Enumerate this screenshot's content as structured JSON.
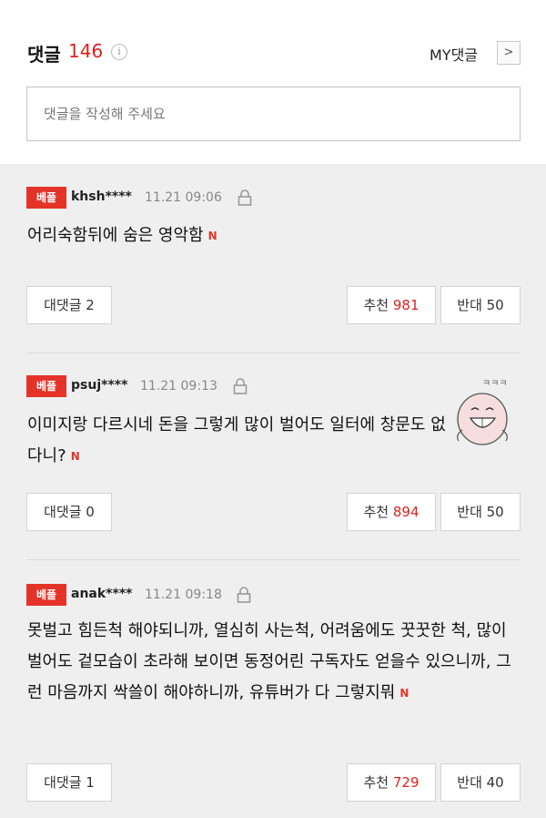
{
  "header": {
    "title": "댓글",
    "count": "146",
    "info_icon": "i",
    "my_link": "MY댓글",
    "arrow_icon": ">"
  },
  "input": {
    "placeholder": "댓글을 작성해 주세요"
  },
  "comments": [
    {
      "badge": "베플",
      "author": "khsh****",
      "time": "11.21 09:06",
      "text": "어리숙함뒤에 숨은 영악함",
      "new_mark": "N",
      "reply_label": "대댓글 2",
      "up_label": "추천",
      "up_count": "981",
      "down_label": "반대 50"
    },
    {
      "badge": "베플",
      "author": "psuj****",
      "time": "11.21 09:13",
      "text": "이미지랑 다르시네 돈을 그렇게 많이 벌어도 일터에 창문도 없다니?",
      "new_mark": "N",
      "reply_label": "대댓글 0",
      "up_label": "추천",
      "up_count": "894",
      "down_label": "반대 50",
      "sticker_text": "ㅋㅋㅋ"
    },
    {
      "badge": "베플",
      "author": "anak****",
      "time": "11.21 09:18",
      "text": "못벌고 힘든척 해야되니까, 열심히 사는척, 어려움에도 꿋꿋한 척, 많이 벌어도 겉모습이 초라해 보이면 동정어린 구독자도 얻을수 있으니까, 그런 마음까지 싹쓸이 해야하니까, 유튜버가 다 그렇지뭐",
      "new_mark": "N",
      "reply_label": "대댓글 1",
      "up_label": "추천",
      "up_count": "729",
      "down_label": "반대 40"
    }
  ],
  "colors": {
    "accent": "#e02020",
    "badge": "#e4342a",
    "list_bg": "#efefef"
  }
}
